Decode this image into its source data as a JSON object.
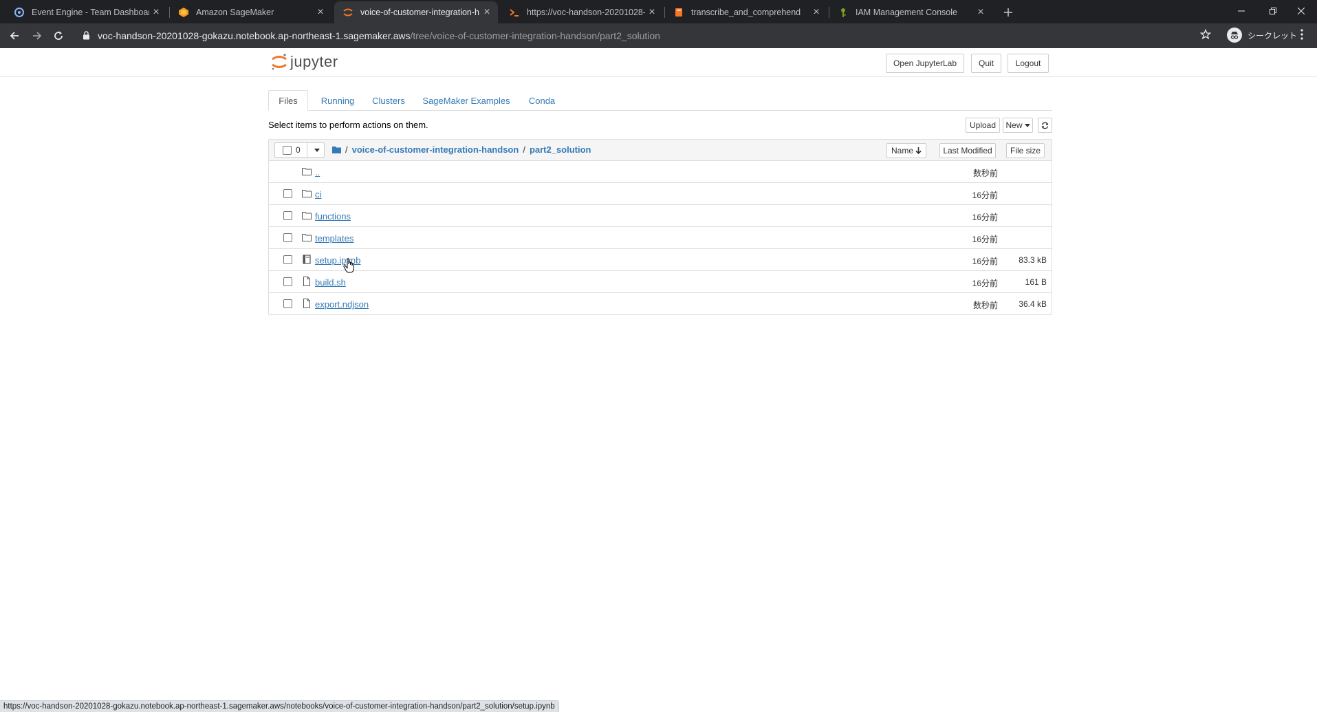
{
  "browser": {
    "tabs": [
      {
        "title": "Event Engine - Team Dashboard",
        "icon": "event-engine-icon",
        "active": false
      },
      {
        "title": "Amazon SageMaker",
        "icon": "sagemaker-icon",
        "active": false
      },
      {
        "title": "voice-of-customer-integration-h",
        "icon": "jupyter-icon",
        "active": true
      },
      {
        "title": "https://voc-handson-20201028-",
        "icon": "terminal-icon",
        "active": false
      },
      {
        "title": "transcribe_and_comprehend",
        "icon": "notebook-icon",
        "active": false
      },
      {
        "title": "IAM Management Console",
        "icon": "iam-icon",
        "active": false
      }
    ],
    "url_host": "voc-handson-20201028-gokazu.notebook.ap-northeast-1.sagemaker.aws",
    "url_path": "/tree/voice-of-customer-integration-handson/part2_solution",
    "profile_label": "シークレット",
    "status_url": "https://voc-handson-20201028-gokazu.notebook.ap-northeast-1.sagemaker.aws/notebooks/voice-of-customer-integration-handson/part2_solution/setup.ipynb"
  },
  "jupyter": {
    "logo_text": "jupyter",
    "header_buttons": {
      "open_lab": "Open JupyterLab",
      "quit": "Quit",
      "logout": "Logout"
    },
    "tabs": [
      "Files",
      "Running",
      "Clusters",
      "SageMaker Examples",
      "Conda"
    ],
    "hint": "Select items to perform actions on them.",
    "upload_label": "Upload",
    "new_label": "New",
    "selected_count": "0",
    "breadcrumb": [
      "voice-of-customer-integration-handson",
      "part2_solution"
    ],
    "columns": {
      "name": "Name",
      "modified": "Last Modified",
      "size": "File size"
    },
    "files": [
      {
        "name": "..",
        "type": "folder",
        "modified": "数秒前",
        "size": ""
      },
      {
        "name": "ci",
        "type": "folder",
        "modified": "16分前",
        "size": ""
      },
      {
        "name": "functions",
        "type": "folder",
        "modified": "16分前",
        "size": ""
      },
      {
        "name": "templates",
        "type": "folder",
        "modified": "16分前",
        "size": ""
      },
      {
        "name": "setup.ipynb",
        "type": "notebook",
        "modified": "16分前",
        "size": "83.3 kB"
      },
      {
        "name": "build.sh",
        "type": "file",
        "modified": "16分前",
        "size": "161 B"
      },
      {
        "name": "export.ndjson",
        "type": "file",
        "modified": "数秒前",
        "size": "36.4 kB"
      }
    ]
  }
}
